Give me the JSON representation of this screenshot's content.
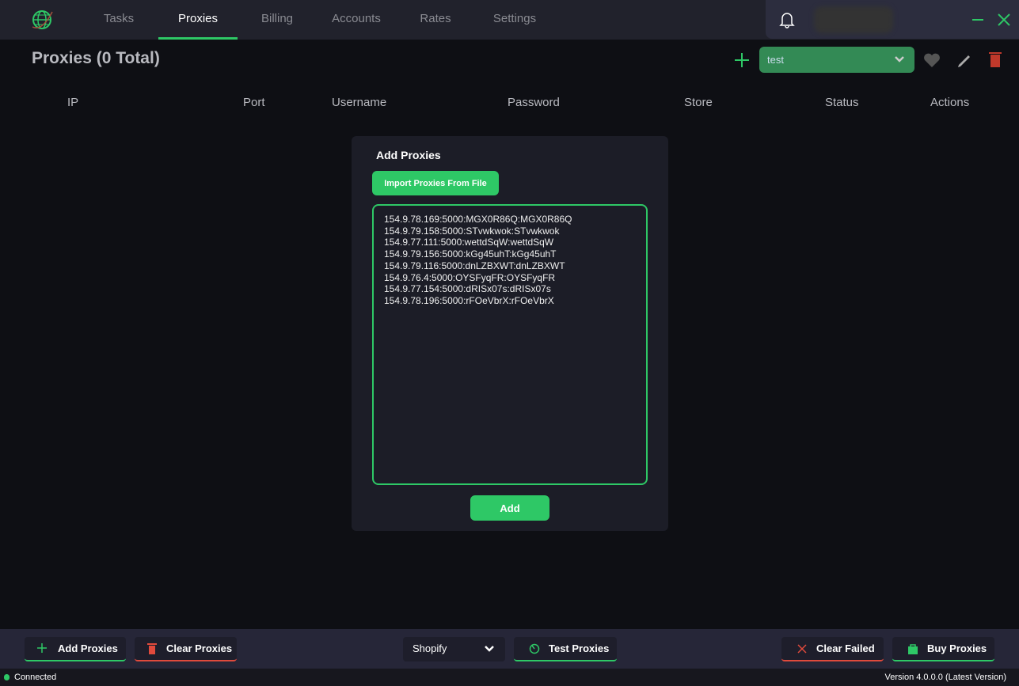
{
  "nav": {
    "tabs": [
      "Tasks",
      "Proxies",
      "Billing",
      "Accounts",
      "Rates",
      "Settings"
    ],
    "active": "Proxies"
  },
  "header": {
    "title": "Proxies (0 Total)",
    "group_select": "test"
  },
  "table": {
    "columns": [
      "IP",
      "Port",
      "Username",
      "Password",
      "Store",
      "Status",
      "Actions"
    ]
  },
  "modal": {
    "title": "Add Proxies",
    "import_label": "Import Proxies From File",
    "add_label": "Add",
    "proxies": "154.9.78.169:5000:MGX0R86Q:MGX0R86Q\n154.9.79.158:5000:STvwkwok:STvwkwok\n154.9.77.111:5000:wettdSqW:wettdSqW\n154.9.79.156:5000:kGg45uhT:kGg45uhT\n154.9.79.116:5000:dnLZBXWT:dnLZBXWT\n154.9.76.4:5000:OYSFyqFR:OYSFyqFR\n154.9.77.154:5000:dRISx07s:dRISx07s\n154.9.78.196:5000:rFOeVbrX:rFOeVbrX"
  },
  "bottom": {
    "add": "Add Proxies",
    "clear": "Clear Proxies",
    "store": "Shopify",
    "test": "Test Proxies",
    "clear_failed": "Clear Failed",
    "buy": "Buy Proxies"
  },
  "footer": {
    "status": "Connected",
    "version": "Version 4.0.0.0 (Latest Version)"
  },
  "colors": {
    "accent": "#2ec866",
    "danger": "#e04a3c"
  }
}
